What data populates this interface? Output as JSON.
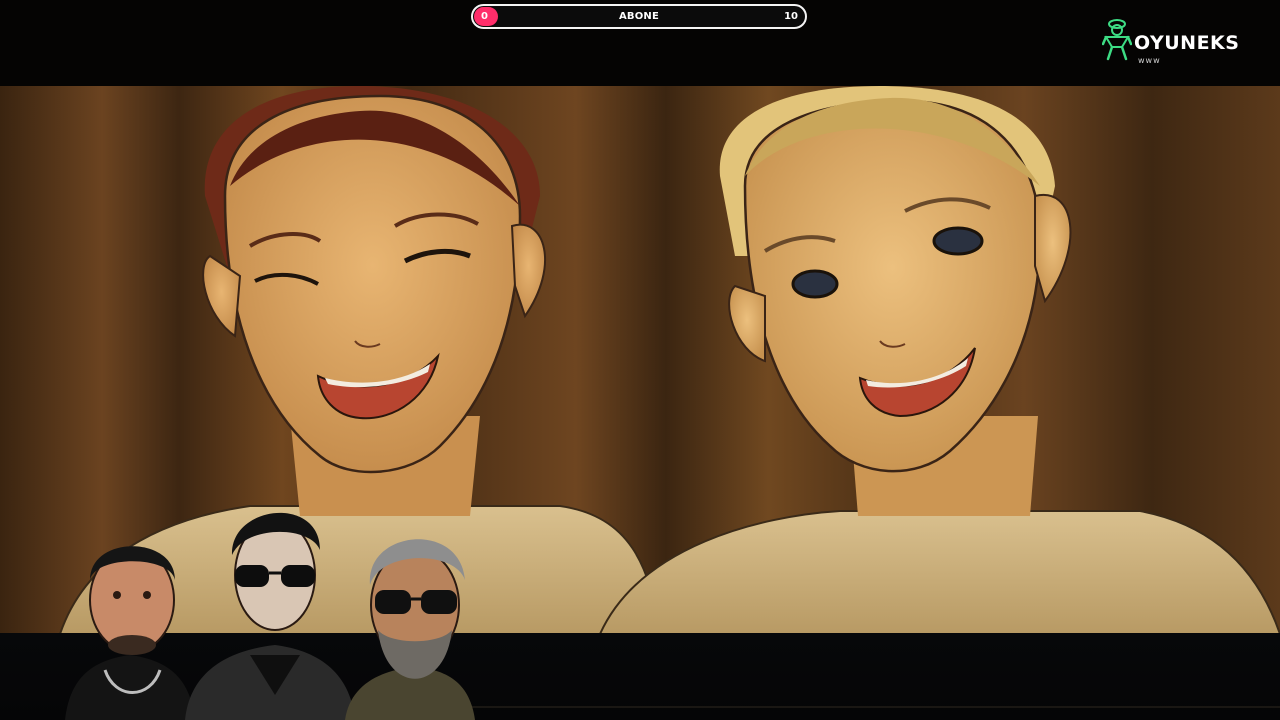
{
  "overlay": {
    "sub_goal": {
      "label": "ABONE",
      "current": "0",
      "target": "10",
      "progress_fraction": 0.0,
      "fill_color": "#ff2d6a"
    },
    "logo": {
      "name": "OYUNEKS",
      "subtext": "www",
      "accent_color": "#3ddc84"
    }
  },
  "video": {
    "description_icon": "anime-women-scene",
    "background_color": "#5a3a1e"
  },
  "webcam": {
    "hosts_icon": "streamer-avatars"
  }
}
